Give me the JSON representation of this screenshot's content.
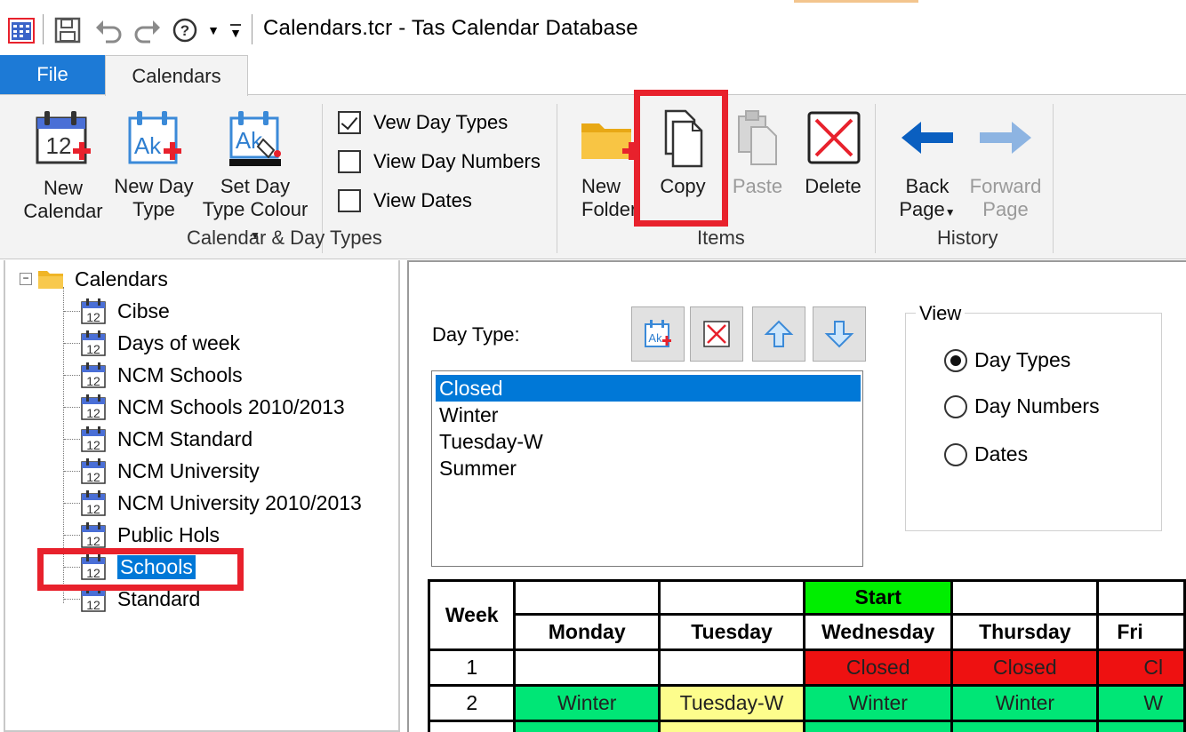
{
  "title_bar": {
    "title": "Calendars.tcr - Tas Calendar Database"
  },
  "ribbon": {
    "tabs": [
      "File",
      "Calendars"
    ],
    "buttons": {
      "new_calendar": "New Calendar",
      "new_day_type": "New Day Type",
      "set_day_type_colour": "Set Day Type Colour",
      "new_folder": "New Folder",
      "copy": "Copy",
      "paste": "Paste",
      "delete": "Delete",
      "back_page": "Back Page",
      "forward_page": "Forward Page"
    },
    "checkboxes": [
      {
        "label": "Vew Day Types",
        "checked": true
      },
      {
        "label": "View Day Numbers",
        "checked": false
      },
      {
        "label": "View Dates",
        "checked": false
      }
    ],
    "groups": [
      "Calendar & Day Types",
      "Items",
      "History"
    ]
  },
  "tree": {
    "root": "Calendars",
    "items": [
      "Cibse",
      "Days of week",
      "NCM Schools",
      "NCM Schools 2010/2013",
      "NCM Standard",
      "NCM University",
      "NCM University 2010/2013",
      "Public Hols",
      "Schools",
      "Standard"
    ],
    "selected": "Schools",
    "icon_number": "12"
  },
  "day_type": {
    "label": "Day Type:",
    "items": [
      "Closed",
      "Winter",
      "Tuesday-W",
      "Summer"
    ],
    "selected": "Closed"
  },
  "view": {
    "legend": "View",
    "options": [
      "Day Types",
      "Day Numbers",
      "Dates"
    ],
    "selected": "Day Types"
  },
  "calendar_table": {
    "week_header": "Week",
    "start_label": "Start",
    "days": [
      "Monday",
      "Tuesday",
      "Wednesday",
      "Thursday",
      "Fri"
    ],
    "rows": [
      {
        "week": "1",
        "cells": [
          "",
          "",
          "Closed",
          "Closed",
          "Cl"
        ]
      },
      {
        "week": "2",
        "cells": [
          "Winter",
          "Tuesday-W",
          "Winter",
          "Winter",
          "W"
        ]
      }
    ]
  },
  "colors": {
    "accent": "#0078d7",
    "highlight": "#e8212c",
    "closed": "#ee1111",
    "winter": "#00e676",
    "tuesday_w": "#fdfd8c",
    "start": "#00ee00"
  }
}
